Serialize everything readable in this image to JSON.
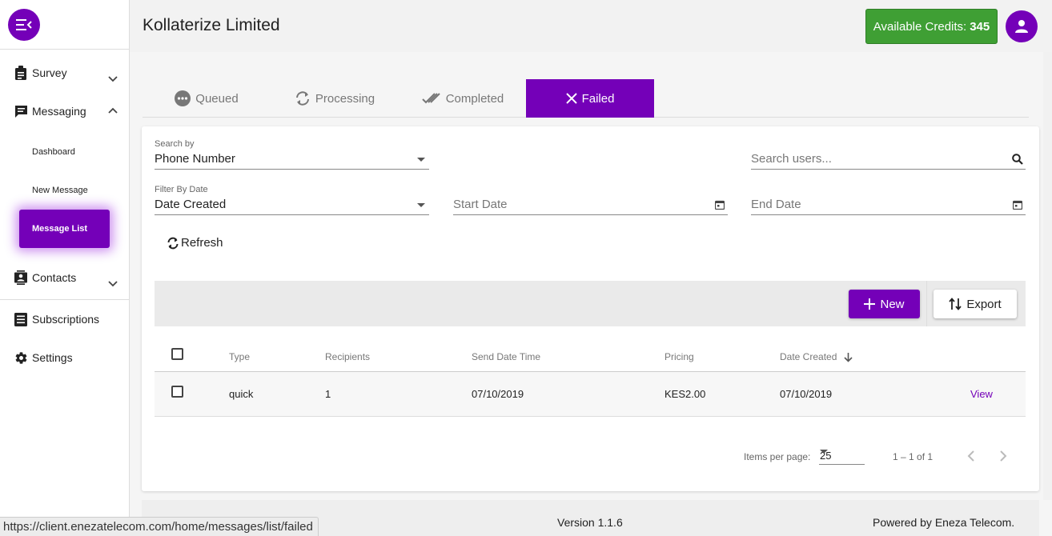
{
  "sidebar": {
    "items": [
      {
        "label": "Survey",
        "icon": "clipboard-icon",
        "expanded": false
      },
      {
        "label": "Messaging",
        "icon": "message-icon",
        "expanded": true,
        "children": [
          "Dashboard",
          "New Message",
          "Message List"
        ]
      },
      {
        "label": "Contacts",
        "icon": "contacts-icon",
        "expanded": false
      },
      {
        "label": "Subscriptions",
        "icon": "list-icon"
      },
      {
        "label": "Settings",
        "icon": "gear-icon"
      }
    ],
    "active_item": "Message List"
  },
  "header": {
    "company_name": "Kollaterize Limited",
    "credits_label": "Available Credits:",
    "credits_value": "345"
  },
  "tabs": [
    {
      "label": "Queued",
      "icon": "more-horiz-icon"
    },
    {
      "label": "Processing",
      "icon": "sync-icon"
    },
    {
      "label": "Completed",
      "icon": "done-all-icon"
    },
    {
      "label": "Failed",
      "icon": "close-icon",
      "active": true
    }
  ],
  "filters": {
    "search_by_label": "Search by",
    "search_by_value": "Phone Number",
    "search_placeholder": "Search users...",
    "filter_date_label": "Filter By Date",
    "filter_date_value": "Date Created",
    "start_date_placeholder": "Start Date",
    "end_date_placeholder": "End Date",
    "refresh_label": "Refresh"
  },
  "toolbar": {
    "new_label": "New",
    "export_label": "Export"
  },
  "table": {
    "columns": [
      "Type",
      "Recipients",
      "Send Date Time",
      "Pricing",
      "Date Created"
    ],
    "sorted_column": "Date Created",
    "sort_direction": "descending",
    "rows": [
      {
        "type": "quick",
        "recipients": "1",
        "send_date_time": "07/10/2019",
        "pricing": "KES2.00",
        "date_created": "07/10/2019",
        "action": "View"
      }
    ]
  },
  "pagination": {
    "items_per_page_label": "Items per page:",
    "items_per_page": "25",
    "range": "1 – 1 of 1"
  },
  "footer": {
    "version": "Version 1.1.6",
    "powered_by": "Powered by Eneza Telecom."
  },
  "status_bar": {
    "url": "https://client.enezatelecom.com/home/messages/list/failed"
  },
  "colors": {
    "brand": "#7400b8",
    "credits_green": "#3f9f34"
  }
}
